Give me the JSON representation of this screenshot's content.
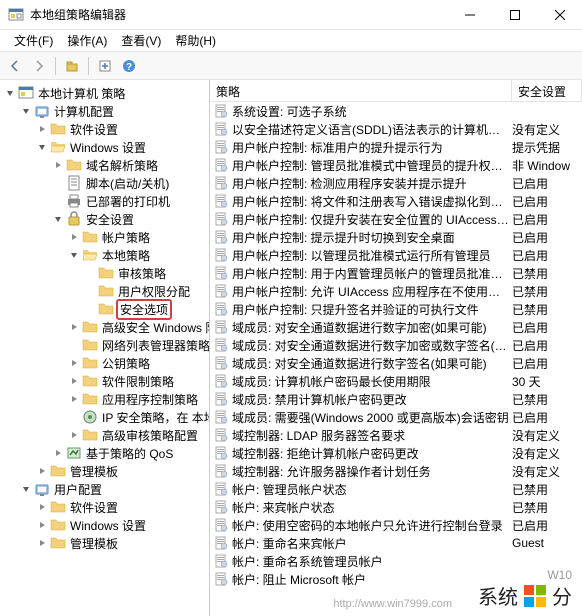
{
  "window": {
    "title": "本地组策略编辑器"
  },
  "menu": {
    "file": "文件(F)",
    "action": "操作(A)",
    "view": "查看(V)",
    "help": "帮助(H)"
  },
  "tree": {
    "root": "本地计算机 策略",
    "computer_config": "计算机配置",
    "software_settings": "软件设置",
    "windows_settings": "Windows 设置",
    "name_resolution": "域名解析策略",
    "scripts": "脚本(启动/关机)",
    "deployed_printers": "已部署的打印机",
    "security_settings": "安全设置",
    "account_policies": "帐户策略",
    "local_policies": "本地策略",
    "audit_policy": "审核策略",
    "user_rights": "用户权限分配",
    "security_options": "安全选项",
    "advanced_firewall": "高级安全 Windows 防火",
    "network_list": "网络列表管理器策略",
    "public_key": "公钥策略",
    "software_restriction": "软件限制策略",
    "app_control": "应用程序控制策略",
    "ip_security": "IP 安全策略，在 本地计",
    "advanced_audit": "高级审核策略配置",
    "qos": "基于策略的 QoS",
    "admin_templates": "管理模板",
    "user_config": "用户配置",
    "user_software": "软件设置",
    "user_windows": "Windows 设置",
    "user_admin_templates": "管理模板"
  },
  "list": {
    "header_policy": "策略",
    "header_setting": "安全设置",
    "items": [
      {
        "name": "系统设置: 可选子系统",
        "setting": ""
      },
      {
        "name": "以安全描述符定义语言(SDDL)语法表示的计算机访问限制",
        "setting": "没有定义"
      },
      {
        "name": "用户帐户控制: 标准用户的提升提示行为",
        "setting": "提示凭据"
      },
      {
        "name": "用户帐户控制: 管理员批准模式中管理员的提升权限提示的...",
        "setting": "非 Window"
      },
      {
        "name": "用户帐户控制: 检测应用程序安装并提示提升",
        "setting": "已启用"
      },
      {
        "name": "用户帐户控制: 将文件和注册表写入错误虚拟化到每用户位置",
        "setting": "已启用"
      },
      {
        "name": "用户帐户控制: 仅提升安装在安全位置的 UIAccess 应用程序",
        "setting": "已启用"
      },
      {
        "name": "用户帐户控制: 提示提升时切换到安全桌面",
        "setting": "已启用"
      },
      {
        "name": "用户帐户控制: 以管理员批准模式运行所有管理员",
        "setting": "已启用"
      },
      {
        "name": "用户帐户控制: 用于内置管理员帐户的管理员批准模式",
        "setting": "已禁用"
      },
      {
        "name": "用户帐户控制: 允许 UIAccess 应用程序在不使用安全桌面...",
        "setting": "已禁用"
      },
      {
        "name": "用户帐户控制: 只提升签名并验证的可执行文件",
        "setting": "已禁用"
      },
      {
        "name": "域成员: 对安全通道数据进行数字加密(如果可能)",
        "setting": "已启用"
      },
      {
        "name": "域成员: 对安全通道数据进行数字加密或数字签名(始终)",
        "setting": "已启用"
      },
      {
        "name": "域成员: 对安全通道数据进行数字签名(如果可能)",
        "setting": "已启用"
      },
      {
        "name": "域成员: 计算机帐户密码最长使用期限",
        "setting": "30 天"
      },
      {
        "name": "域成员: 禁用计算机帐户密码更改",
        "setting": "已禁用"
      },
      {
        "name": "域成员: 需要强(Windows 2000 或更高版本)会话密钥",
        "setting": "已启用"
      },
      {
        "name": "域控制器: LDAP 服务器签名要求",
        "setting": "没有定义"
      },
      {
        "name": "域控制器: 拒绝计算机帐户密码更改",
        "setting": "没有定义"
      },
      {
        "name": "域控制器: 允许服务器操作者计划任务",
        "setting": "没有定义"
      },
      {
        "name": "帐户: 管理员帐户状态",
        "setting": "已禁用"
      },
      {
        "name": "帐户: 来宾帐户状态",
        "setting": "已禁用"
      },
      {
        "name": "帐户: 使用空密码的本地帐户只允许进行控制台登录",
        "setting": "已启用"
      },
      {
        "name": "帐户: 重命名来宾帐户",
        "setting": "Guest"
      },
      {
        "name": "帐户: 重命名系统管理员帐户",
        "setting": ""
      },
      {
        "name": "帐户: 阻止 Microsoft 帐户",
        "setting": ""
      }
    ]
  },
  "watermark": {
    "text": "系统",
    "text2": "分",
    "small": "W10",
    "url": "http://www.win7999.com"
  }
}
